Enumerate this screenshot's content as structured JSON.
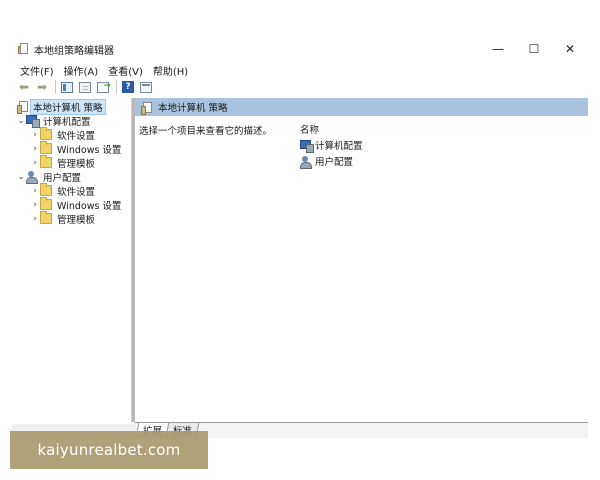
{
  "window": {
    "title": "本地组策略编辑器",
    "controls": {
      "minimize": "—",
      "maximize": "☐",
      "close": "✕"
    }
  },
  "menu": {
    "items": [
      "文件(F)",
      "操作(A)",
      "查看(V)",
      "帮助(H)"
    ]
  },
  "toolbar": {
    "icons": [
      "back-arrow-icon",
      "forward-arrow-icon",
      "show-hide-tree-icon",
      "view-list-icon",
      "export-list-icon",
      "help-icon",
      "properties-icon"
    ],
    "back_glyph": "⬅",
    "forward_glyph": "➡",
    "help_glyph": "?"
  },
  "tree": {
    "root": "本地计算机 策略",
    "computer_config": {
      "label": "计算机配置",
      "children": [
        "软件设置",
        "Windows 设置",
        "管理模板"
      ]
    },
    "user_config": {
      "label": "用户配置",
      "children": [
        "软件设置",
        "Windows 设置",
        "管理模板"
      ]
    },
    "toggle_expanded": "⌄",
    "toggle_collapsed": "›"
  },
  "right_pane": {
    "header": "本地计算机 策略",
    "description": "选择一个项目来查看它的描述。",
    "column_name": "名称",
    "items": [
      "计算机配置",
      "用户配置"
    ]
  },
  "tabs": [
    "扩展",
    "标准"
  ],
  "watermark": "kaiyunrealbet.com",
  "colors": {
    "header_bar": "#a9c2de",
    "selection": "#cfe4f7",
    "watermark_bg": "#a89a6e"
  }
}
